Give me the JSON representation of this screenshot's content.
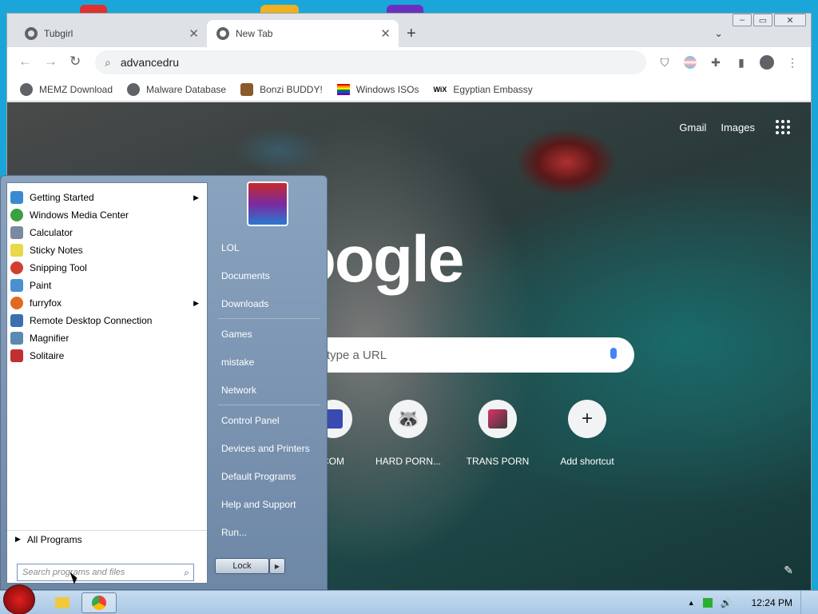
{
  "browser": {
    "tabs": [
      {
        "label": "Tubgirl",
        "active": false
      },
      {
        "label": "New Tab",
        "active": true
      }
    ],
    "address": "advancedru",
    "bookmarks": [
      {
        "label": "MEMZ Download",
        "icon": "globe-icon"
      },
      {
        "label": "Malware Database",
        "icon": "globe-icon"
      },
      {
        "label": "Bonzi BUDDY!",
        "icon": "bonzi-icon"
      },
      {
        "label": "Windows ISOs",
        "icon": "rainbow-flag-icon"
      },
      {
        "label": "Egyptian Embassy",
        "icon": "wix-icon"
      }
    ],
    "wix_label": "WiX"
  },
  "newtab": {
    "links": [
      "Gmail",
      "Images"
    ],
    "logo": "Google",
    "search_placeholder": "type a URL",
    "shortcuts": [
      {
        "label": "COM"
      },
      {
        "label": "HARD PORN..."
      },
      {
        "label": "TRANS PORN"
      },
      {
        "label": "Add shortcut"
      }
    ]
  },
  "start_menu": {
    "programs": [
      {
        "label": "Getting Started",
        "submenu": true,
        "color": "#3a8ad0"
      },
      {
        "label": "Windows Media Center",
        "submenu": false,
        "color": "#3aa040"
      },
      {
        "label": "Calculator",
        "submenu": false,
        "color": "#7a8aa0"
      },
      {
        "label": "Sticky Notes",
        "submenu": false,
        "color": "#e8d84a"
      },
      {
        "label": "Snipping Tool",
        "submenu": false,
        "color": "#d04030"
      },
      {
        "label": "Paint",
        "submenu": false,
        "color": "#4a90d0"
      },
      {
        "label": "furryfox",
        "submenu": true,
        "color": "#e06a20"
      },
      {
        "label": "Remote Desktop Connection",
        "submenu": false,
        "color": "#3a70b0"
      },
      {
        "label": "Magnifier",
        "submenu": false,
        "color": "#5a8ab0"
      },
      {
        "label": "Solitaire",
        "submenu": false,
        "color": "#c03030"
      }
    ],
    "all_programs": "All Programs",
    "search_placeholder": "Search programs and files",
    "right_items": [
      "LOL",
      "Documents",
      "Downloads",
      "Games",
      "mistake",
      "Network",
      "Control Panel",
      "Devices and Printers",
      "Default Programs",
      "Help and Support",
      "Run..."
    ],
    "lock_label": "Lock"
  },
  "taskbar": {
    "clock": "12:24 PM"
  }
}
